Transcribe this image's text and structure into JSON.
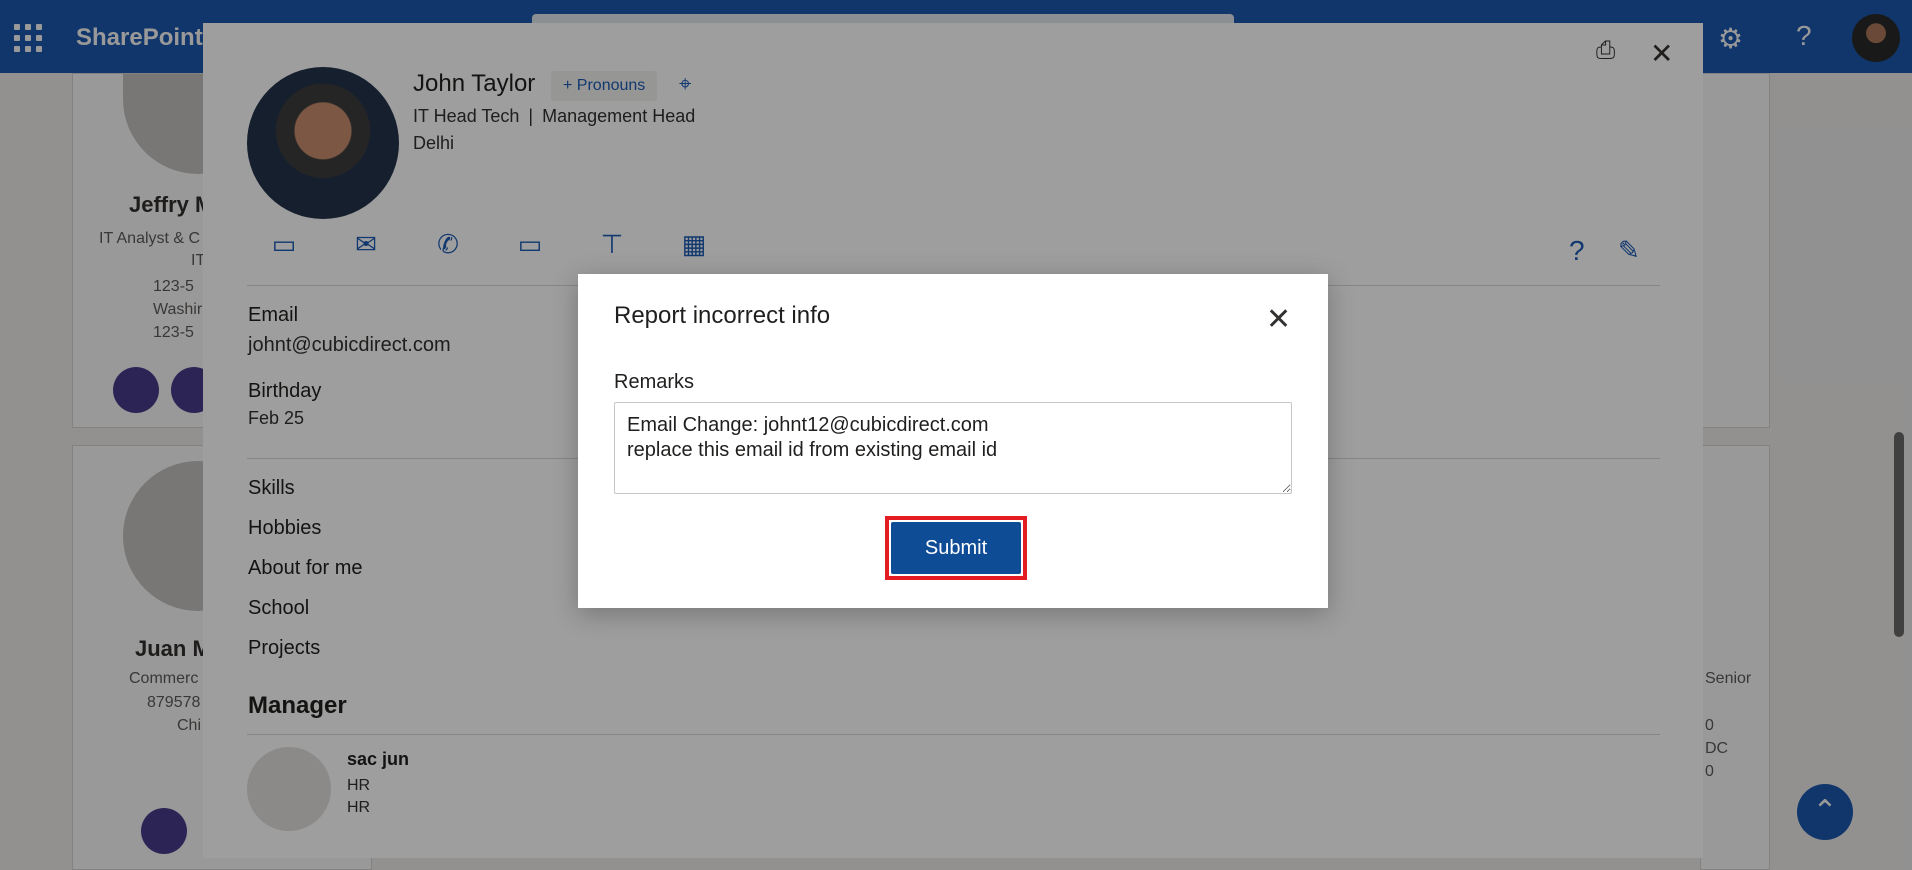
{
  "suite": {
    "app_name": "SharePoint"
  },
  "background_cards": {
    "card1": {
      "name": "Jeffry M",
      "line1": "IT Analyst & C",
      "line2": "IT",
      "phone": "123-5",
      "location": "Washir",
      "phone2": "123-5"
    },
    "card2": {
      "name": "Juan M",
      "line1": "Commerc",
      "phone": "879578",
      "location": "Chi"
    },
    "card_right": {
      "line1": "Senior",
      "line2": "0",
      "line3": "DC",
      "line4": "0"
    }
  },
  "profile": {
    "name": "John Taylor",
    "pronouns_label": "+ Pronouns",
    "title": "IT Head Tech",
    "separator": "|",
    "department": "Management Head",
    "location": "Delhi",
    "fields": [
      {
        "label": "Email",
        "value": "johnt@cubicdirect.com"
      },
      {
        "label": "Birthday",
        "value": "Feb 25"
      }
    ],
    "sections": [
      "Skills",
      "Hobbies",
      "About for me",
      "School",
      "Projects"
    ],
    "manager_heading": "Manager",
    "manager": {
      "name": "sac jun",
      "line1": "HR",
      "line2": "HR"
    }
  },
  "dialog": {
    "title": "Report incorrect info",
    "remarks_label": "Remarks",
    "remarks_value": "Email Change: johnt12@cubicdirect.com\nreplace this email id from existing email id",
    "submit_label": "Submit"
  },
  "colors": {
    "brand": "#1c5bb3",
    "submit_bg": "#0f4c96",
    "highlight": "#e31b23"
  }
}
